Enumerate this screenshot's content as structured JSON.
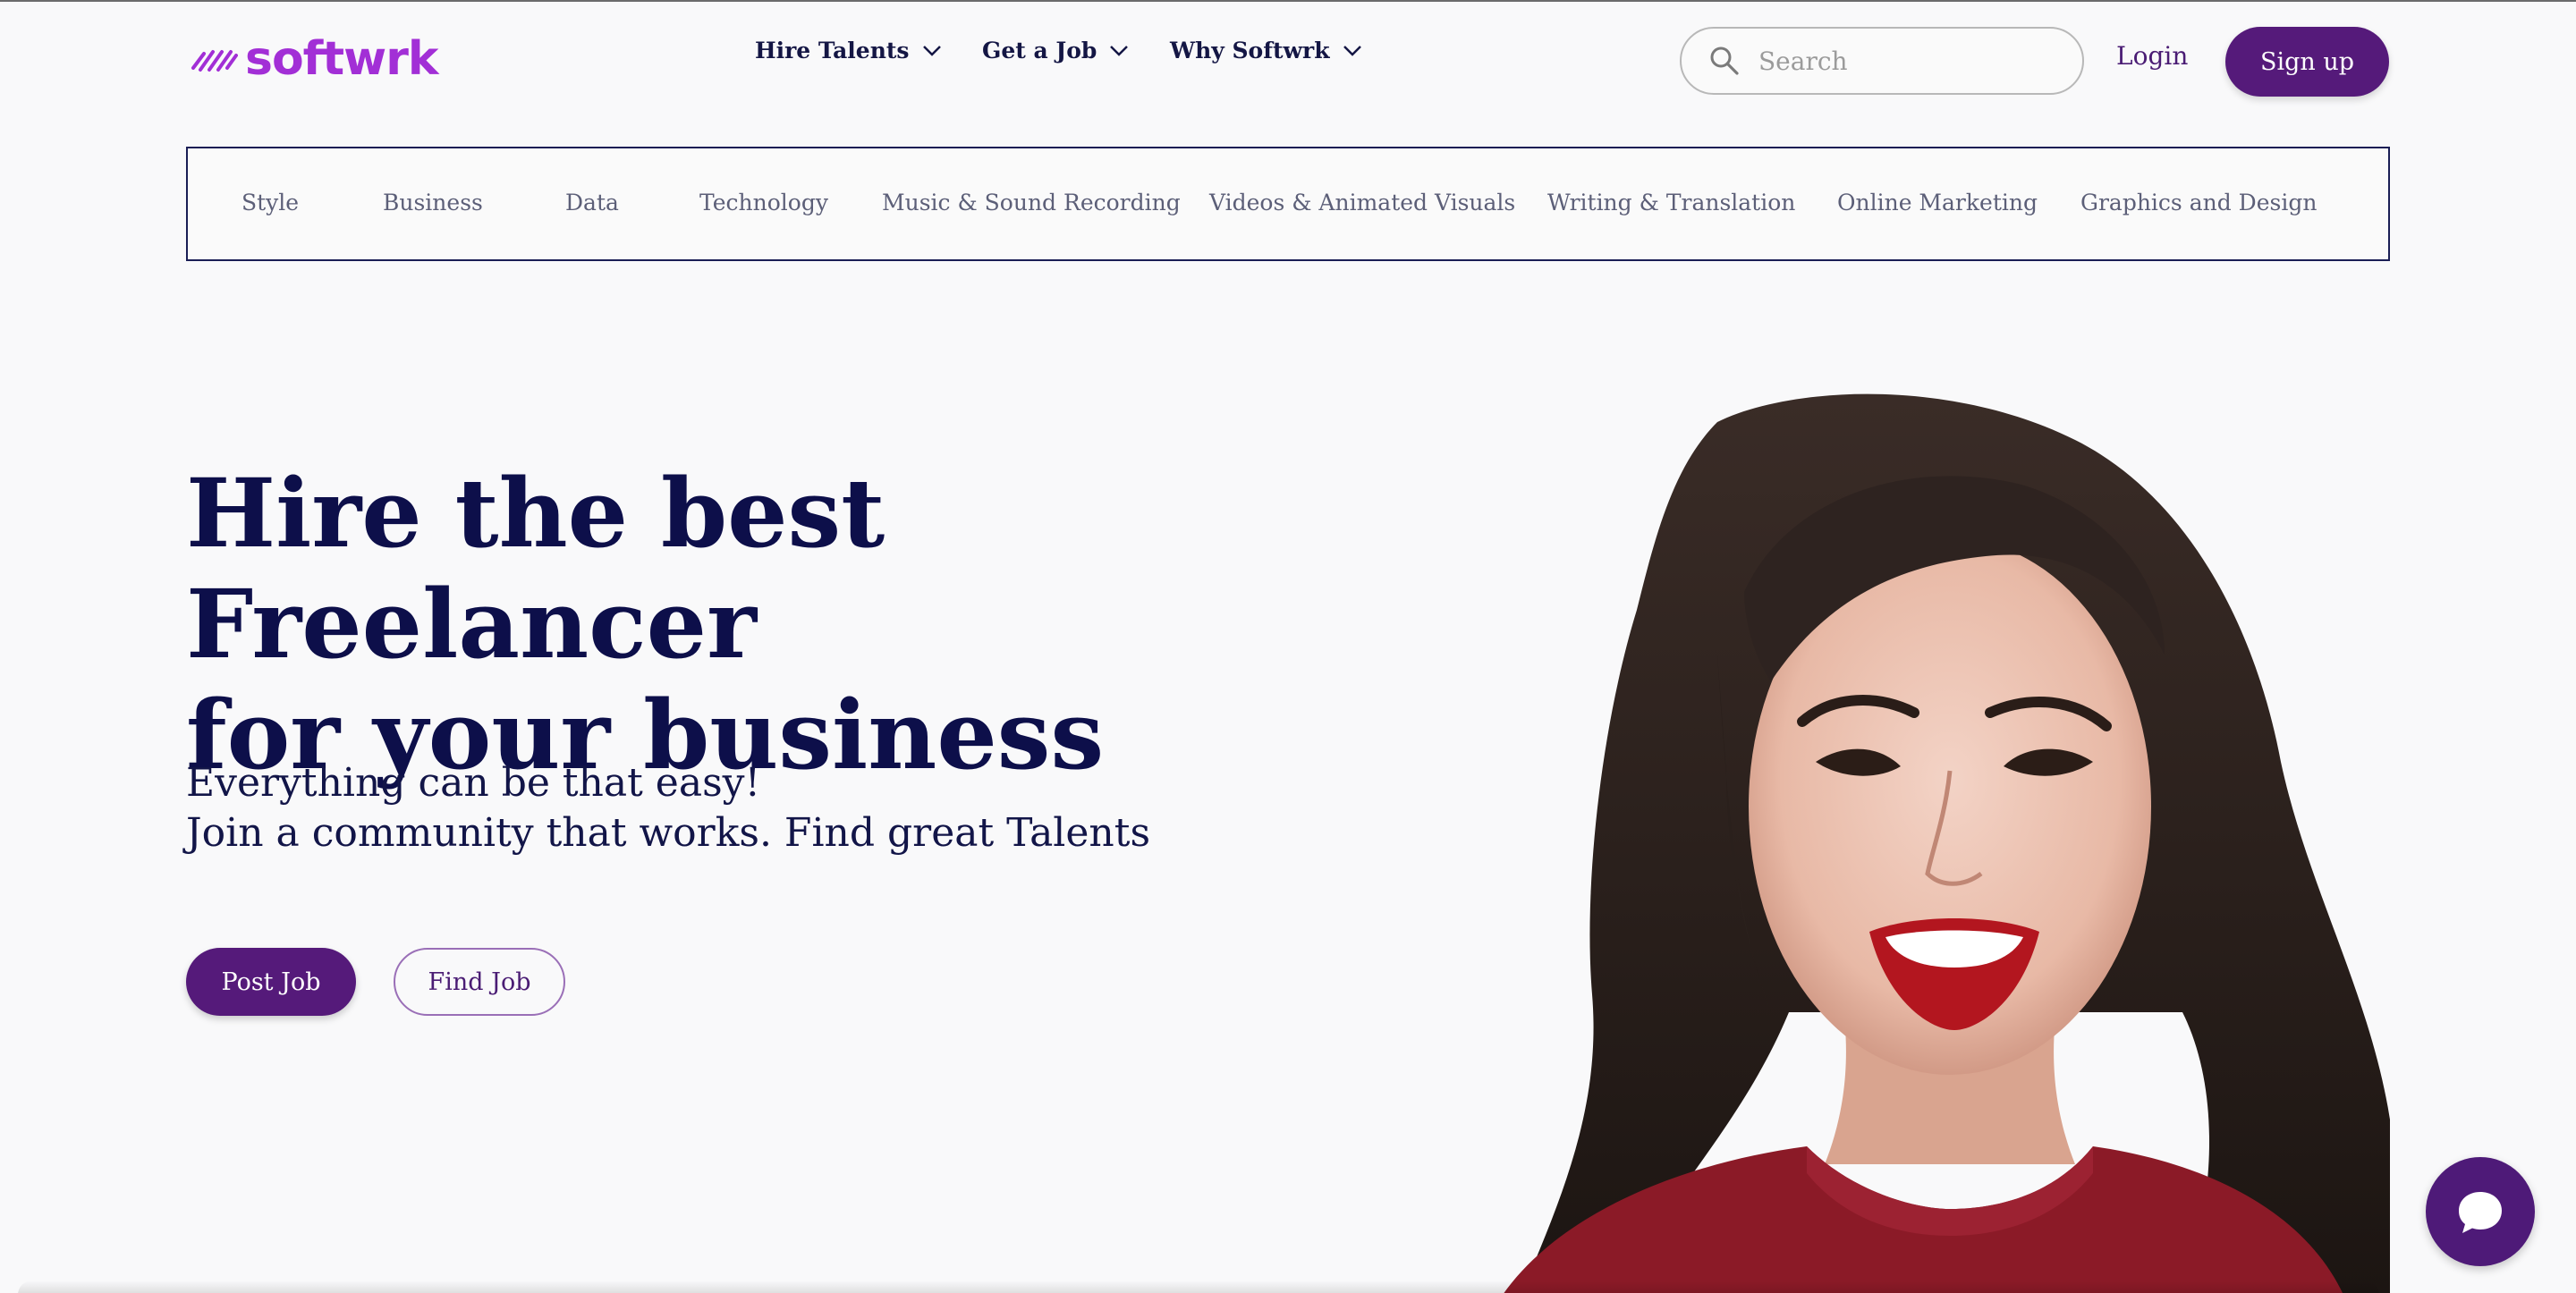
{
  "brand": {
    "name": "softwrk",
    "color": "#a22fd6",
    "primary": "#551a7a",
    "heading_color": "#0d0f4a"
  },
  "nav": {
    "items": [
      {
        "label": "Hire Talents",
        "icon": "chevron-down-icon"
      },
      {
        "label": "Get a Job",
        "icon": "chevron-down-icon"
      },
      {
        "label": "Why Softwrk",
        "icon": "chevron-down-icon"
      }
    ]
  },
  "search": {
    "placeholder": "Search",
    "value": "",
    "icon": "search-icon"
  },
  "auth": {
    "login_label": "Login",
    "signup_label": "Sign up"
  },
  "categories": [
    "Style",
    "Business",
    "Data",
    "Technology",
    "Music & Sound Recording",
    "Videos & Animated Visuals",
    "Writing & Translation",
    "Online Marketing",
    "Graphics and Design"
  ],
  "hero": {
    "title_lines": [
      "Hire the best Freelancer",
      "for your business"
    ],
    "subtitle_lines": [
      "Everything can be that easy!",
      "Join a community that works. Find great Talents"
    ],
    "post_job_label": "Post Job",
    "find_job_label": "Find Job"
  },
  "chat": {
    "icon": "chat-bubble-icon"
  }
}
